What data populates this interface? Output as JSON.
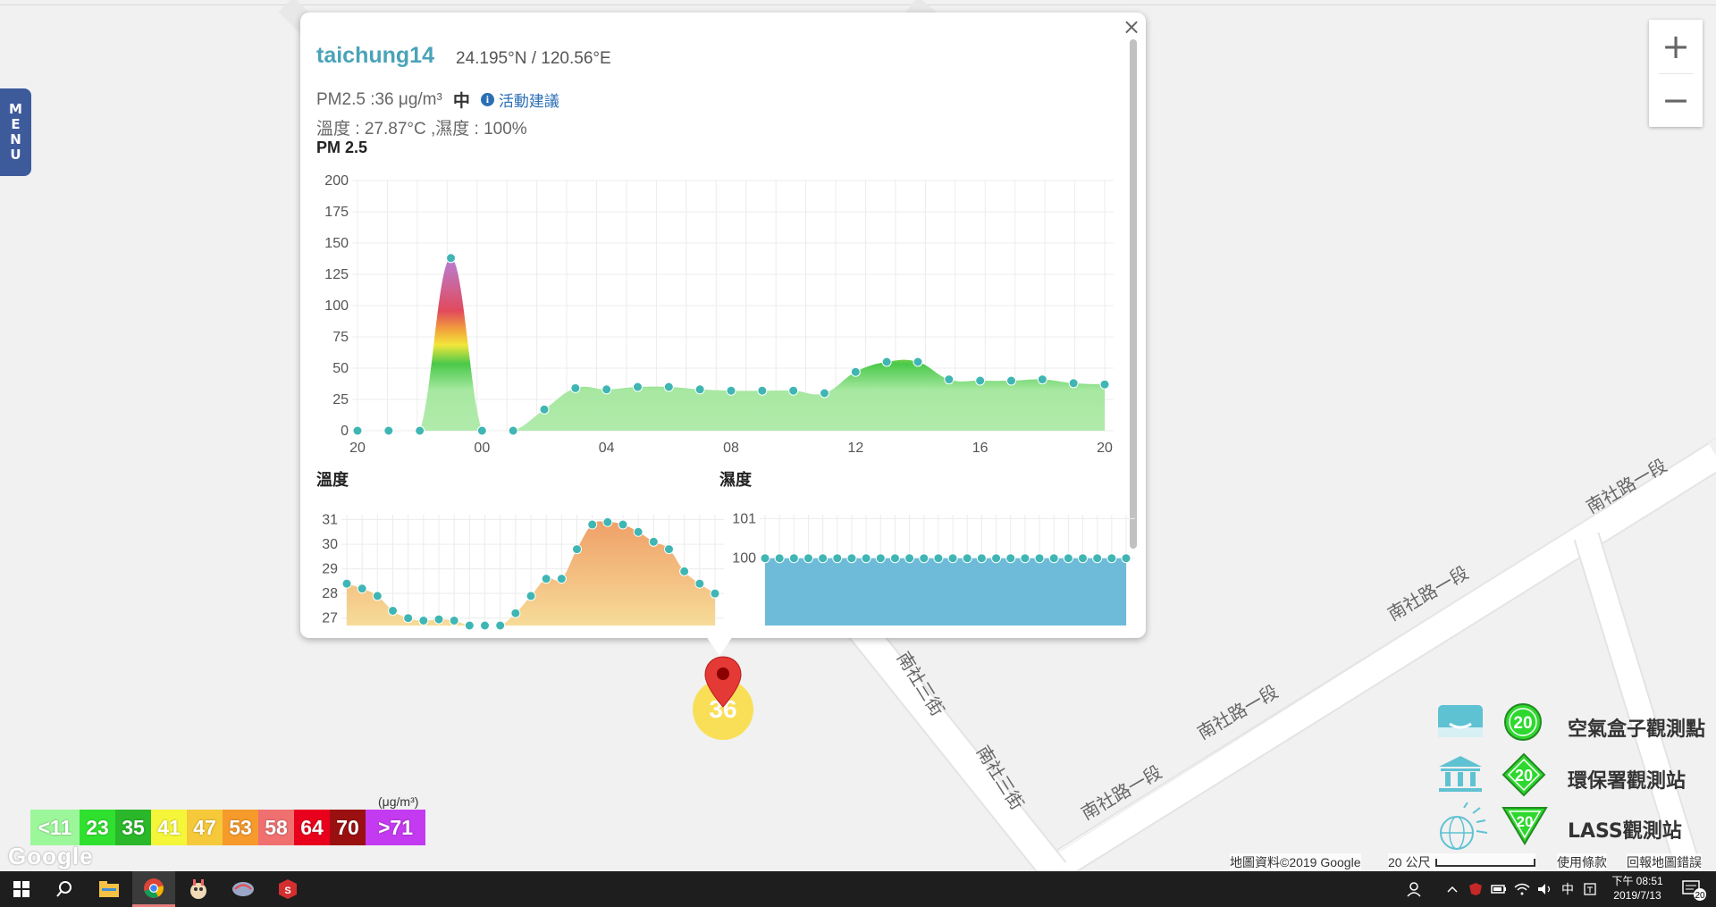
{
  "menu": {
    "label": "MENU",
    "letters": [
      "M",
      "E",
      "N",
      "U"
    ]
  },
  "zoom": {
    "in": "+",
    "out": "−"
  },
  "info": {
    "station": "taichung14",
    "coords": "24.195°N / 120.56°E",
    "pm_text": "PM2.5 :36 μg/m³",
    "pm_level": "中",
    "advice": "活動建議",
    "env_text": "溫度 : 27.87°C ,濕度 : 100%",
    "close": "×"
  },
  "chart_data": [
    {
      "type": "area",
      "title": "PM 2.5",
      "x_ticks": [
        "20",
        "00",
        "04",
        "08",
        "12",
        "16",
        "20"
      ],
      "y_ticks": [
        0,
        25,
        50,
        75,
        100,
        125,
        150,
        175,
        200
      ],
      "ylim": [
        0,
        200
      ],
      "values": [
        0,
        0,
        0,
        138,
        0,
        0,
        17,
        34,
        33,
        35,
        35,
        33,
        32,
        32,
        32,
        30,
        47,
        55,
        55,
        41,
        40,
        40,
        41,
        38,
        37
      ],
      "grid": true
    },
    {
      "type": "area",
      "title": "溫度",
      "y_ticks": [
        27,
        28,
        29,
        30,
        31
      ],
      "ylim": [
        26.7,
        31.2
      ],
      "values": [
        28.4,
        28.2,
        27.9,
        27.3,
        27.0,
        26.9,
        26.95,
        26.9,
        26.7,
        26.7,
        26.7,
        27.2,
        27.9,
        28.6,
        28.6,
        29.8,
        30.8,
        30.9,
        30.8,
        30.5,
        30.1,
        29.8,
        28.9,
        28.4,
        28.0
      ],
      "grid": true
    },
    {
      "type": "area",
      "title": "濕度",
      "y_ticks": [
        100,
        101
      ],
      "ylim": [
        98.3,
        101.1
      ],
      "values": [
        100,
        100,
        100,
        100,
        100,
        100,
        100,
        100,
        100,
        100,
        100,
        100,
        100,
        100,
        100,
        100,
        100,
        100,
        100,
        100,
        100,
        100,
        100,
        100,
        100,
        100
      ],
      "grid": true
    }
  ],
  "marker": {
    "value": "36"
  },
  "aq_legend": {
    "unit": "(μg/m³)",
    "cells": [
      {
        "label": "<11",
        "color": "#9cf79a"
      },
      {
        "label": "23",
        "color": "#30e02e"
      },
      {
        "label": "35",
        "color": "#2ab72a"
      },
      {
        "label": "41",
        "color": "#f5f53a"
      },
      {
        "label": "47",
        "color": "#f5c93a"
      },
      {
        "label": "53",
        "color": "#f59a2b"
      },
      {
        "label": "58",
        "color": "#f07070"
      },
      {
        "label": "64",
        "color": "#e8001c"
      },
      {
        "label": "70",
        "color": "#9a1010"
      },
      {
        "label": ">71",
        "color": "#c43af0"
      }
    ]
  },
  "google": "Google",
  "streets": [
    "南社路一段",
    "南社路一段",
    "南社路一段",
    "南社路一段",
    "南社三街",
    "南社三街"
  ],
  "station_legend": [
    {
      "label": "空氣盒子觀測點",
      "badge": "20"
    },
    {
      "label": "環保署觀測站",
      "badge": "20"
    },
    {
      "label": "LASS觀測站",
      "badge": "20"
    }
  ],
  "attribution": {
    "map_data": "地圖資料©2019 Google",
    "scale": "20 公尺",
    "terms": "使用條款",
    "report": "回報地圖錯誤"
  },
  "taskbar": {
    "time_label": "下午 08:51",
    "date": "2019/7/13",
    "ime": "中",
    "notif_count": "20"
  },
  "colors": {
    "accent": "#4aa3b8",
    "menu": "#3d5a9b",
    "point": "#3fb6b4"
  }
}
